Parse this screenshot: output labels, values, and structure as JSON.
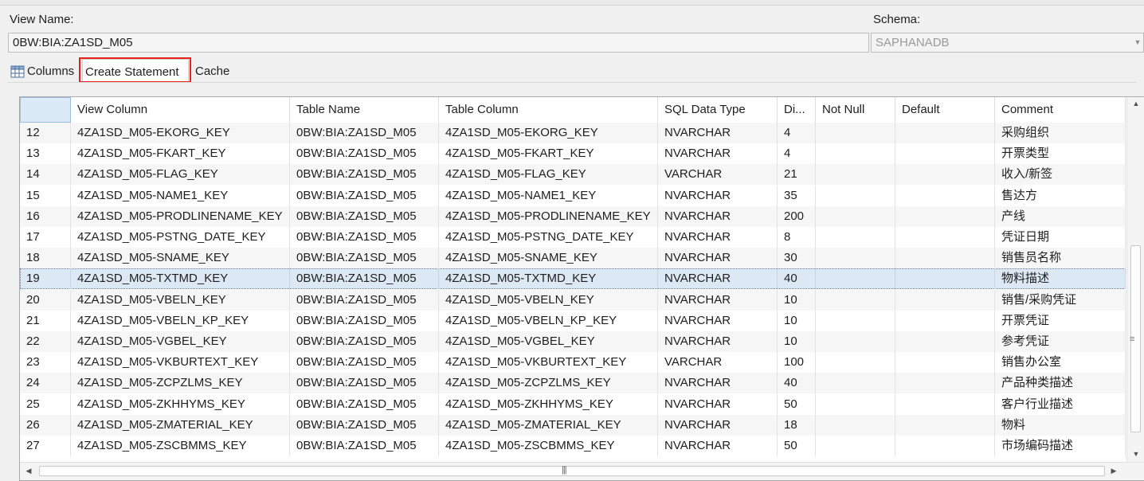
{
  "view": {
    "name_label": "View Name:",
    "name_value": "0BW:BIA:ZA1SD_M05",
    "schema_label": "Schema:",
    "schema_value": "SAPHANADB"
  },
  "tabs": [
    {
      "label": "Columns",
      "icon": "table-icon"
    },
    {
      "label": "Create Statement"
    },
    {
      "label": "Cache"
    }
  ],
  "table": {
    "headers": [
      "",
      "View Column",
      "Table Name",
      "Table Column",
      "SQL Data Type",
      "Di...",
      "Not Null",
      "Default",
      "Comment"
    ],
    "rows": [
      [
        "12",
        "4ZA1SD_M05-EKORG_KEY",
        "0BW:BIA:ZA1SD_M05",
        "4ZA1SD_M05-EKORG_KEY",
        "NVARCHAR",
        "4",
        "",
        "",
        "采购组织"
      ],
      [
        "13",
        "4ZA1SD_M05-FKART_KEY",
        "0BW:BIA:ZA1SD_M05",
        "4ZA1SD_M05-FKART_KEY",
        "NVARCHAR",
        "4",
        "",
        "",
        "开票类型"
      ],
      [
        "14",
        "4ZA1SD_M05-FLAG_KEY",
        "0BW:BIA:ZA1SD_M05",
        "4ZA1SD_M05-FLAG_KEY",
        "VARCHAR",
        "21",
        "",
        "",
        "收入/新签"
      ],
      [
        "15",
        "4ZA1SD_M05-NAME1_KEY",
        "0BW:BIA:ZA1SD_M05",
        "4ZA1SD_M05-NAME1_KEY",
        "NVARCHAR",
        "35",
        "",
        "",
        "售达方"
      ],
      [
        "16",
        "4ZA1SD_M05-PRODLINENAME_KEY",
        "0BW:BIA:ZA1SD_M05",
        "4ZA1SD_M05-PRODLINENAME_KEY",
        "NVARCHAR",
        "200",
        "",
        "",
        "产线"
      ],
      [
        "17",
        "4ZA1SD_M05-PSTNG_DATE_KEY",
        "0BW:BIA:ZA1SD_M05",
        "4ZA1SD_M05-PSTNG_DATE_KEY",
        "NVARCHAR",
        "8",
        "",
        "",
        "凭证日期"
      ],
      [
        "18",
        "4ZA1SD_M05-SNAME_KEY",
        "0BW:BIA:ZA1SD_M05",
        "4ZA1SD_M05-SNAME_KEY",
        "NVARCHAR",
        "30",
        "",
        "",
        "销售员名称"
      ],
      [
        "19",
        "4ZA1SD_M05-TXTMD_KEY",
        "0BW:BIA:ZA1SD_M05",
        "4ZA1SD_M05-TXTMD_KEY",
        "NVARCHAR",
        "40",
        "",
        "",
        "物料描述"
      ],
      [
        "20",
        "4ZA1SD_M05-VBELN_KEY",
        "0BW:BIA:ZA1SD_M05",
        "4ZA1SD_M05-VBELN_KEY",
        "NVARCHAR",
        "10",
        "",
        "",
        "销售/采购凭证"
      ],
      [
        "21",
        "4ZA1SD_M05-VBELN_KP_KEY",
        "0BW:BIA:ZA1SD_M05",
        "4ZA1SD_M05-VBELN_KP_KEY",
        "NVARCHAR",
        "10",
        "",
        "",
        "开票凭证"
      ],
      [
        "22",
        "4ZA1SD_M05-VGBEL_KEY",
        "0BW:BIA:ZA1SD_M05",
        "4ZA1SD_M05-VGBEL_KEY",
        "NVARCHAR",
        "10",
        "",
        "",
        "参考凭证"
      ],
      [
        "23",
        "4ZA1SD_M05-VKBURTEXT_KEY",
        "0BW:BIA:ZA1SD_M05",
        "4ZA1SD_M05-VKBURTEXT_KEY",
        "VARCHAR",
        "100",
        "",
        "",
        "销售办公室"
      ],
      [
        "24",
        "4ZA1SD_M05-ZCPZLMS_KEY",
        "0BW:BIA:ZA1SD_M05",
        "4ZA1SD_M05-ZCPZLMS_KEY",
        "NVARCHAR",
        "40",
        "",
        "",
        "产品种类描述"
      ],
      [
        "25",
        "4ZA1SD_M05-ZKHHYMS_KEY",
        "0BW:BIA:ZA1SD_M05",
        "4ZA1SD_M05-ZKHHYMS_KEY",
        "NVARCHAR",
        "50",
        "",
        "",
        "客户行业描述"
      ],
      [
        "26",
        "4ZA1SD_M05-ZMATERIAL_KEY",
        "0BW:BIA:ZA1SD_M05",
        "4ZA1SD_M05-ZMATERIAL_KEY",
        "NVARCHAR",
        "18",
        "",
        "",
        "物料"
      ],
      [
        "27",
        "4ZA1SD_M05-ZSCBMMS_KEY",
        "0BW:BIA:ZA1SD_M05",
        "4ZA1SD_M05-ZSCBMMS_KEY",
        "NVARCHAR",
        "50",
        "",
        "",
        "市场编码描述"
      ]
    ],
    "selected_row": "19"
  },
  "colors": {
    "highlight_box": "#e8201a",
    "selected_row_bg": "#dde8f5"
  }
}
